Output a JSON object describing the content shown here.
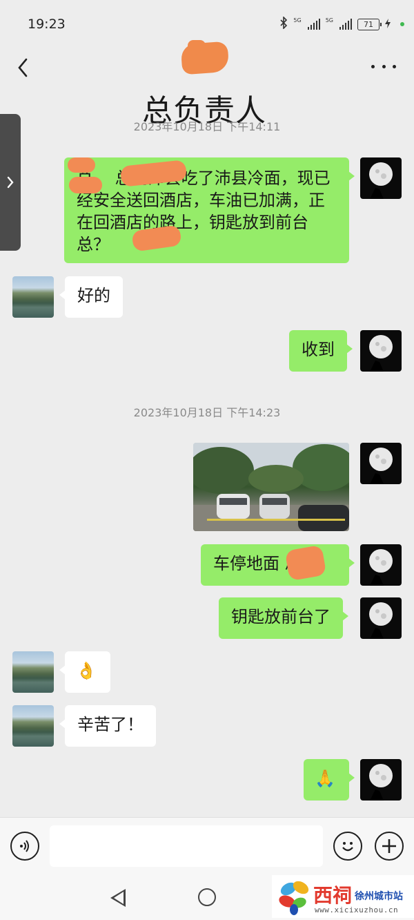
{
  "status_bar": {
    "time": "19:23",
    "signal_label_1": "5G",
    "signal_label_2": "5G",
    "battery": "71"
  },
  "header": {
    "title_redacted": true
  },
  "overlay_title": "总负责人",
  "timestamps": {
    "first": "2023年10月18日 下午14:11",
    "second": "2023年10月18日 下午14:23"
  },
  "messages": {
    "m1": "总，  总到沛县吃了沛县冷面，现已经安全送回酒店，车油已加满，正在回酒店的路上，钥匙放到前台   总？",
    "m2": "好的",
    "m3": "收到",
    "m4_type": "image",
    "m5": "车停地面  总",
    "m6": "钥匙放前台了",
    "m7_emoji": "👌",
    "m8": "辛苦了！",
    "m9_emoji": "🙏"
  },
  "input_bar": {
    "value": ""
  },
  "watermark": {
    "brand": "西祠",
    "city": "徐州城市站",
    "url": "www.xicixuzhou.cn"
  },
  "colors": {
    "background": "#ededed",
    "outgoing_bubble": "#95ec69",
    "incoming_bubble": "#ffffff",
    "redaction": "#f28b54"
  },
  "icons": [
    "back-icon",
    "more-icon",
    "voice-icon",
    "emoji-icon",
    "plus-icon",
    "bluetooth-icon",
    "battery-icon",
    "signal-icon",
    "chevron-right-icon",
    "nav-back-icon",
    "nav-home-icon"
  ]
}
